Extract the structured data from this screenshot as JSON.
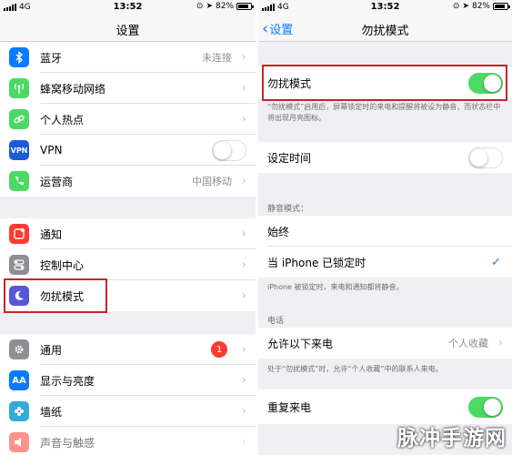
{
  "left": {
    "status": {
      "carrier": "4G",
      "time": "13:52",
      "battery": "82%"
    },
    "nav_title": "设置",
    "group1": [
      {
        "icon": "bluetooth-icon",
        "color": "#0a7aff",
        "label": "蓝牙",
        "value": "未连接",
        "accessory": "chevron"
      },
      {
        "icon": "cellular-antenna-icon",
        "color": "#4cd964",
        "label": "蜂窝移动网络",
        "value": "",
        "accessory": "chevron"
      },
      {
        "icon": "hotspot-link-icon",
        "color": "#4cd964",
        "label": "个人热点",
        "value": "",
        "accessory": "chevron"
      },
      {
        "icon": "vpn-icon",
        "color": "#1a5bd8",
        "icon_text": "VPN",
        "label": "VPN",
        "value": "",
        "accessory": "toggle-off"
      },
      {
        "icon": "phone-icon",
        "color": "#4cd964",
        "label": "运营商",
        "value": "中国移动",
        "accessory": "chevron"
      }
    ],
    "group2": [
      {
        "icon": "notifications-icon",
        "color": "#ff3b30",
        "label": "通知"
      },
      {
        "icon": "control-center-icon",
        "color": "#8e8e93",
        "label": "控制中心"
      },
      {
        "icon": "moon-icon",
        "color": "#5856d6",
        "label": "勿扰模式"
      }
    ],
    "group3": [
      {
        "icon": "gear-icon",
        "color": "#8e8e93",
        "label": "通用",
        "badge": "1"
      },
      {
        "icon": "text-size-icon",
        "color": "#0a7aff",
        "icon_text": "AA",
        "label": "显示与亮度"
      },
      {
        "icon": "wallpaper-flower-icon",
        "color": "#34aadc",
        "label": "墙纸"
      },
      {
        "icon": "speaker-icon",
        "color": "#ff3b30",
        "label": "声音与触感"
      }
    ]
  },
  "right": {
    "status": {
      "carrier": "4G",
      "time": "13:52",
      "battery": "82%"
    },
    "back_label": "设置",
    "nav_title": "勿扰模式",
    "dnd_label": "勿扰模式",
    "dnd_on": true,
    "dnd_note": "“勿扰模式”启用后，屏幕锁定时的来电和提醒将被设为静音，而状态栏中将出现月亮图标。",
    "schedule_label": "设定时间",
    "schedule_on": false,
    "silence_header": "静音模式：",
    "always_label": "始终",
    "locked_label": "当 iPhone 已锁定时",
    "silence_note": "iPhone 被锁定时，来电和通知都将静音。",
    "phone_header": "电话",
    "allow_label": "允许以下来电",
    "allow_value": "个人收藏",
    "allow_note": "处于“勿扰模式”时，允许“个人收藏”中的联系人来电。",
    "repeat_label": "重复来电",
    "repeat_on": true
  },
  "watermark": "脉冲手游网",
  "colors": {
    "accent": "#0a7aff",
    "switch_on": "#4cd964",
    "highlight_box": "#c9232a"
  }
}
